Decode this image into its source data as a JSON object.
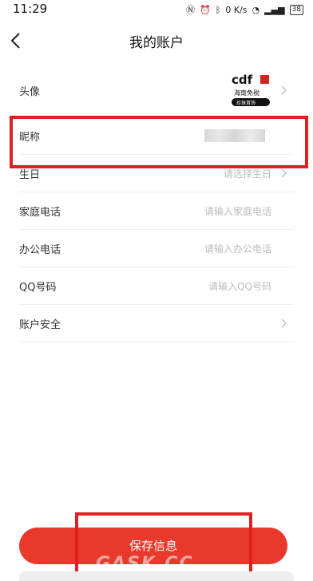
{
  "status": {
    "time": "11:29",
    "net": "0 K/s",
    "battery": "38"
  },
  "header": {
    "title": "我的账户"
  },
  "rows": [
    {
      "label": "头像"
    },
    {
      "label": "昵称"
    },
    {
      "label": "生日",
      "placeholder": "请选择生日"
    },
    {
      "label": "家庭电话",
      "placeholder": "请输入家庭电话"
    },
    {
      "label": "办公电话",
      "placeholder": "请输入办公电话"
    },
    {
      "label": "QQ号码",
      "placeholder": "请输入QQ号码"
    },
    {
      "label": "账户安全"
    }
  ],
  "avatar_logo": {
    "brand": "cdf",
    "line1": "海南免税",
    "line2": "珍珠首饰"
  },
  "save_button": {
    "label": "保存信息"
  },
  "watermark": {
    "text": "GASK.CC"
  },
  "colors": {
    "accent": "#e8392c",
    "highlight": "#e02020"
  }
}
